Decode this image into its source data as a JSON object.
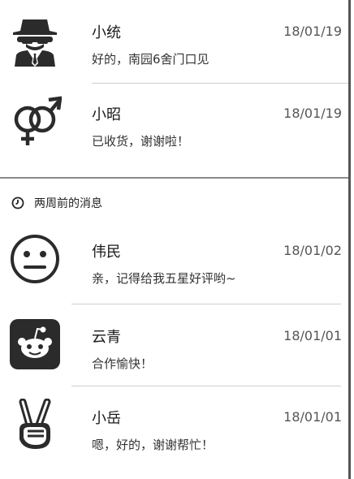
{
  "recent": [
    {
      "name": "小统",
      "date": "18/01/19",
      "preview": "好的，南园6舍门口见",
      "avatar_icon": "spy-icon"
    },
    {
      "name": "小昭",
      "date": "18/01/19",
      "preview": "已收货，谢谢啦！",
      "avatar_icon": "gender-symbols-icon"
    }
  ],
  "section": {
    "label": "两周前的消息",
    "icon": "clock-icon"
  },
  "older": [
    {
      "name": "伟民",
      "date": "18/01/02",
      "preview": "亲，记得给我五星好评哟~",
      "avatar_icon": "neutral-face-icon"
    },
    {
      "name": "云青",
      "date": "18/01/01",
      "preview": "合作愉快！",
      "avatar_icon": "reddit-alien-icon"
    },
    {
      "name": "小岳",
      "date": "18/01/01",
      "preview": "嗯，好的，谢谢帮忙！",
      "avatar_icon": "victory-hand-icon"
    }
  ],
  "colors": {
    "text": "#222222",
    "date": "#555555",
    "divider": "#cfcfcf",
    "icon_fill": "#2b2b2b"
  }
}
